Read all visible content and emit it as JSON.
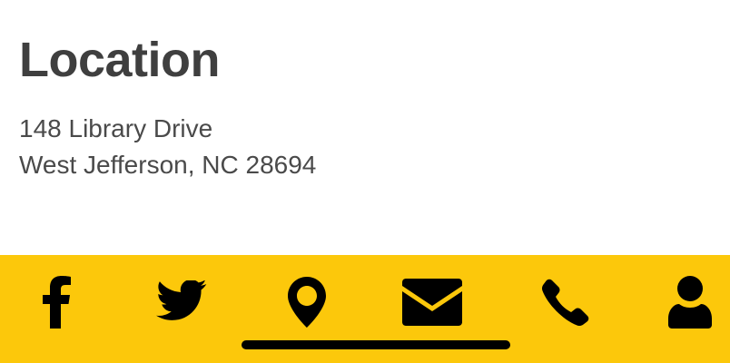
{
  "location": {
    "title": "Location",
    "address_line1": "148 Library Drive",
    "address_line2": "West Jefferson, NC 28694"
  },
  "bottom_bar": {
    "background_color": "#fcc80b",
    "icon_color": "#000000",
    "icons": [
      "facebook-icon",
      "twitter-icon",
      "map-pin-icon",
      "envelope-icon",
      "phone-icon",
      "user-icon"
    ]
  }
}
